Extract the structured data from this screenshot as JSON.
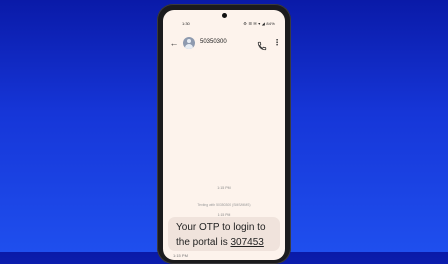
{
  "status_bar": {
    "time": "1:30",
    "icons": "⚙ ☰ ✉ ▾ ◢ 84%"
  },
  "conversation": {
    "contact_name": "50350300",
    "back_icon": "arrow-back-icon",
    "call_icon": "phone-icon",
    "more_icon": "more-vert-icon"
  },
  "messages": {
    "top_time": "1:15 PM",
    "texting_with": "Texting with 50350300 (SMS/MMS)",
    "sent_time": "1:15 PM",
    "otp_message": {
      "text_before": "Your OTP to login to the portal is ",
      "otp_code": "307453",
      "time": "1:15 PM"
    }
  },
  "colors": {
    "background_top": "#0a1aa8",
    "background_bottom": "#1f4fee",
    "screen_bg": "#fdf3ec",
    "bubble_bg": "#f0e3dc"
  }
}
